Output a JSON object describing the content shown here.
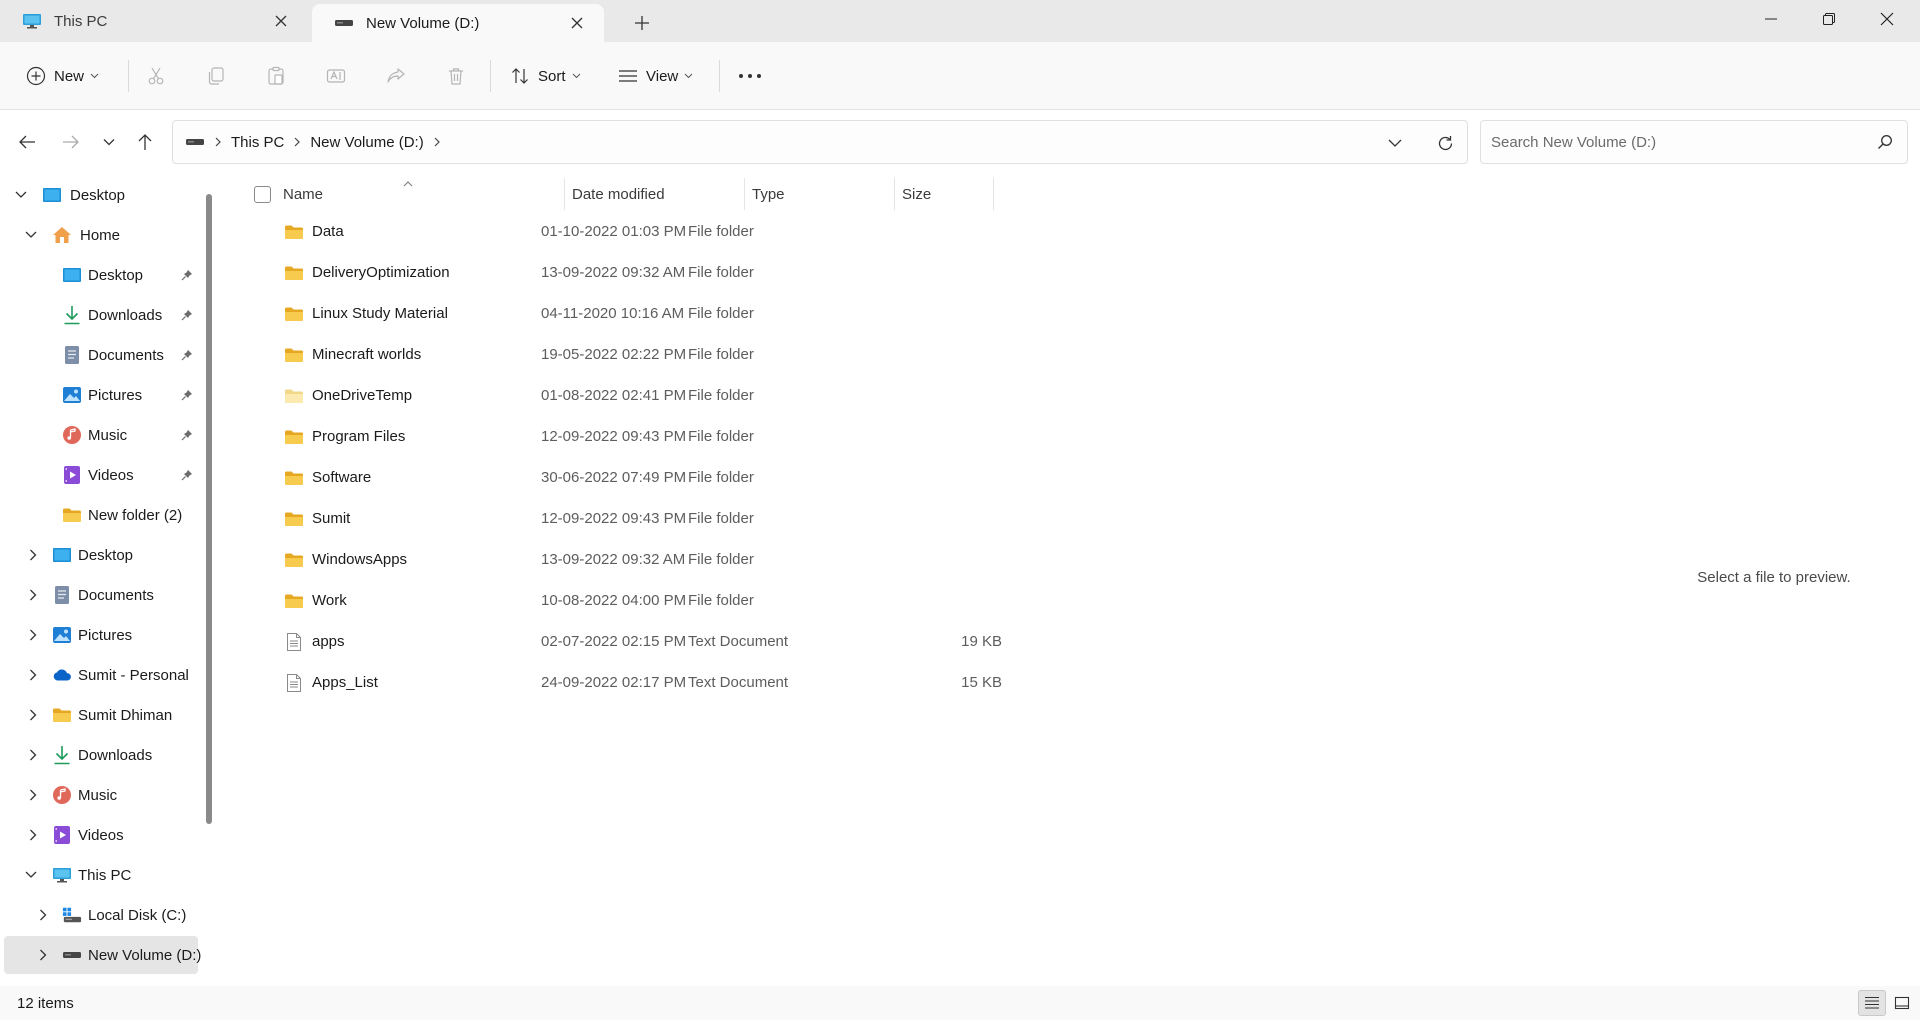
{
  "tabs": [
    {
      "title": "This PC",
      "icon": "monitor-icon",
      "active": false
    },
    {
      "title": "New Volume (D:)",
      "icon": "drive-icon",
      "active": true
    }
  ],
  "window_controls": [
    "minimize-icon",
    "restore-icon",
    "close-icon"
  ],
  "toolbar": {
    "new_label": "New",
    "sort_label": "Sort",
    "view_label": "View",
    "disabled_actions": [
      "cut-icon",
      "copy-icon",
      "paste-icon",
      "rename-icon",
      "share-icon",
      "delete-icon"
    ]
  },
  "address": {
    "crumbs": [
      "This PC",
      "New Volume (D:)"
    ]
  },
  "search": {
    "placeholder": "Search New Volume (D:)"
  },
  "sidebar": {
    "items": [
      {
        "label": "Desktop",
        "icon": "desktop-icon",
        "expanded": true,
        "level": 0,
        "pinned": false
      },
      {
        "label": "Home",
        "icon": "home-icon",
        "expanded": true,
        "level": 1,
        "pinned": false
      },
      {
        "label": "Desktop",
        "icon": "desktop-icon",
        "level": 2,
        "pinned": true
      },
      {
        "label": "Downloads",
        "icon": "download-icon",
        "level": 2,
        "pinned": true
      },
      {
        "label": "Documents",
        "icon": "documents-icon",
        "level": 2,
        "pinned": true
      },
      {
        "label": "Pictures",
        "icon": "pictures-icon",
        "level": 2,
        "pinned": true
      },
      {
        "label": "Music",
        "icon": "music-icon",
        "level": 2,
        "pinned": true
      },
      {
        "label": "Videos",
        "icon": "videos-icon",
        "level": 2,
        "pinned": true
      },
      {
        "label": "New folder (2)",
        "icon": "folder-icon",
        "level": 2,
        "pinned": false
      },
      {
        "label": "Desktop",
        "icon": "desktop-icon",
        "collapsed": true,
        "level": 1
      },
      {
        "label": "Documents",
        "icon": "documents-icon",
        "collapsed": true,
        "level": 1
      },
      {
        "label": "Pictures",
        "icon": "pictures-icon",
        "collapsed": true,
        "level": 1
      },
      {
        "label": "Sumit - Personal",
        "icon": "onedrive-icon",
        "collapsed": true,
        "level": 1
      },
      {
        "label": "Sumit Dhiman",
        "icon": "folder-icon",
        "collapsed": true,
        "level": 1
      },
      {
        "label": "Downloads",
        "icon": "download-icon",
        "collapsed": true,
        "level": 1
      },
      {
        "label": "Music",
        "icon": "music-icon",
        "collapsed": true,
        "level": 1
      },
      {
        "label": "Videos",
        "icon": "videos-icon",
        "collapsed": true,
        "level": 1
      },
      {
        "label": "This PC",
        "icon": "monitor-icon",
        "expanded": true,
        "level": 1
      },
      {
        "label": "Local Disk (C:)",
        "icon": "windows-drive-icon",
        "collapsed": true,
        "level": 2
      },
      {
        "label": "New Volume (D:)",
        "icon": "drive-icon",
        "collapsed": true,
        "level": 2,
        "selected": true
      }
    ]
  },
  "columns": {
    "name": "Name",
    "date": "Date modified",
    "type": "Type",
    "size": "Size"
  },
  "files": [
    {
      "name": "Data",
      "date": "01-10-2022 01:03 PM",
      "type": "File folder",
      "size": "",
      "kind": "folder"
    },
    {
      "name": "DeliveryOptimization",
      "date": "13-09-2022 09:32 AM",
      "type": "File folder",
      "size": "",
      "kind": "folder"
    },
    {
      "name": "Linux Study Material",
      "date": "04-11-2020 10:16 AM",
      "type": "File folder",
      "size": "",
      "kind": "folder"
    },
    {
      "name": "Minecraft worlds",
      "date": "19-05-2022 02:22 PM",
      "type": "File folder",
      "size": "",
      "kind": "folder"
    },
    {
      "name": "OneDriveTemp",
      "date": "01-08-2022 02:41 PM",
      "type": "File folder",
      "size": "",
      "kind": "folder-light"
    },
    {
      "name": "Program Files",
      "date": "12-09-2022 09:43 PM",
      "type": "File folder",
      "size": "",
      "kind": "folder"
    },
    {
      "name": "Software",
      "date": "30-06-2022 07:49 PM",
      "type": "File folder",
      "size": "",
      "kind": "folder"
    },
    {
      "name": "Sumit",
      "date": "12-09-2022 09:43 PM",
      "type": "File folder",
      "size": "",
      "kind": "folder"
    },
    {
      "name": "WindowsApps",
      "date": "13-09-2022 09:32 AM",
      "type": "File folder",
      "size": "",
      "kind": "folder"
    },
    {
      "name": "Work",
      "date": "10-08-2022 04:00 PM",
      "type": "File folder",
      "size": "",
      "kind": "folder"
    },
    {
      "name": "apps",
      "date": "02-07-2022 02:15 PM",
      "type": "Text Document",
      "size": "19 KB",
      "kind": "text"
    },
    {
      "name": "Apps_List",
      "date": "24-09-2022 02:17 PM",
      "type": "Text Document",
      "size": "15 KB",
      "kind": "text"
    }
  ],
  "preview": {
    "message": "Select a file to preview."
  },
  "status": {
    "count": "12 items"
  },
  "colors": {
    "folder": "#f4c542",
    "accent": "#0067c0",
    "selected_bg": "#e5e5e5"
  }
}
